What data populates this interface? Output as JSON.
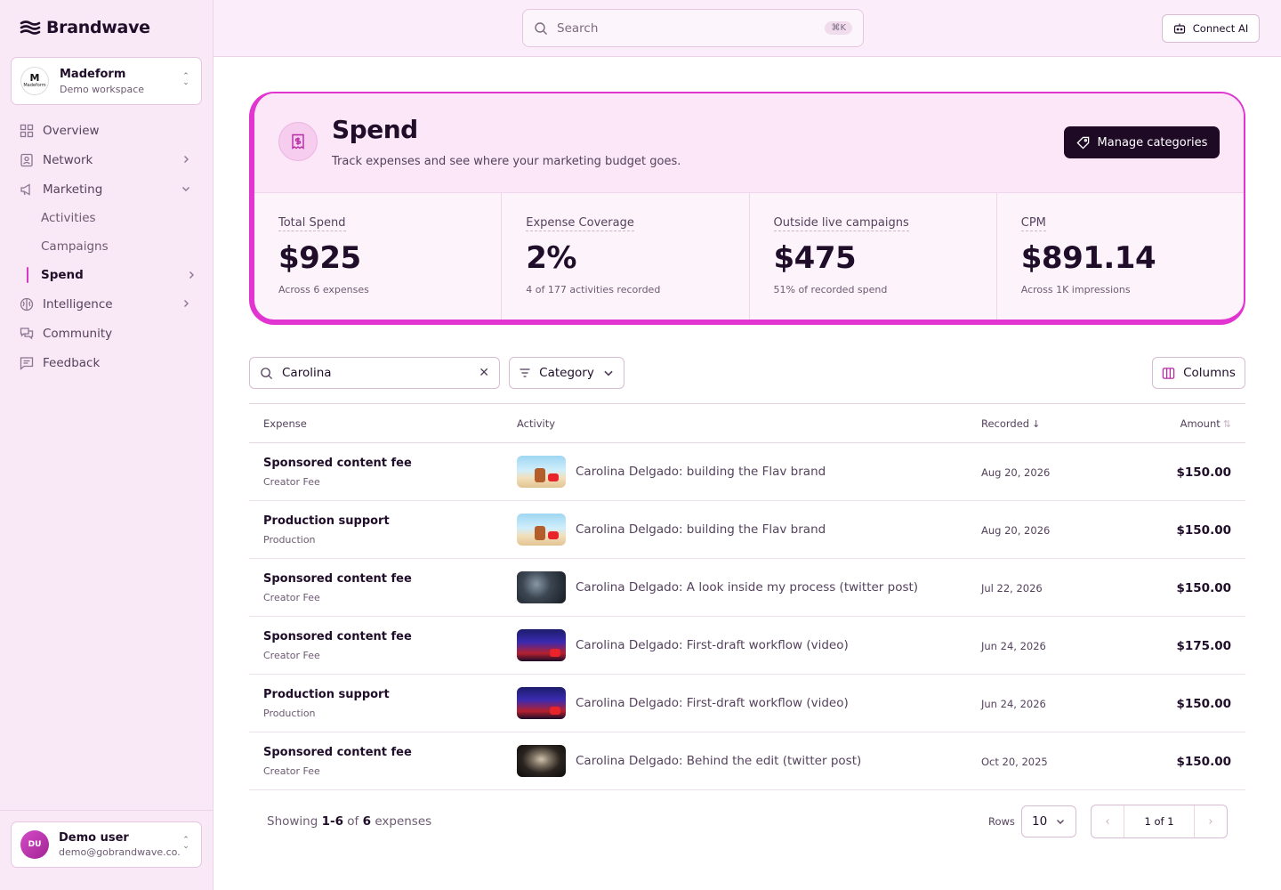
{
  "brand": {
    "name": "Brandwave"
  },
  "workspace": {
    "logo_text": "M",
    "logo_sub": "Madeform",
    "name": "Madeform",
    "subtitle": "Demo workspace"
  },
  "nav": {
    "overview": "Overview",
    "network": "Network",
    "marketing": "Marketing",
    "marketing_sub": [
      "Activities",
      "Campaigns",
      "Spend"
    ],
    "intelligence": "Intelligence",
    "community": "Community",
    "feedback": "Feedback"
  },
  "user": {
    "initials": "DU",
    "name": "Demo user",
    "email": "demo@gobrandwave.co..."
  },
  "topbar": {
    "search_placeholder": "Search",
    "shortcut": "⌘K",
    "connect_label": "Connect AI"
  },
  "page": {
    "title": "Spend",
    "subtitle": "Track expenses and see where your marketing budget goes.",
    "manage_label": "Manage categories"
  },
  "stats": [
    {
      "label": "Total Spend",
      "value": "$925",
      "sub": "Across 6 expenses"
    },
    {
      "label": "Expense Coverage",
      "value": "2%",
      "sub": "4 of 177 activities recorded"
    },
    {
      "label": "Outside live campaigns",
      "value": "$475",
      "sub": "51% of recorded spend"
    },
    {
      "label": "CPM",
      "value": "$891.14",
      "sub": "Across 1K impressions"
    }
  ],
  "filters": {
    "search_value": "Carolina",
    "category_label": "Category",
    "columns_label": "Columns"
  },
  "table": {
    "headers": {
      "expense": "Expense",
      "activity": "Activity",
      "recorded": "Recorded",
      "amount": "Amount"
    },
    "rows": [
      {
        "expense": "Sponsored content fee",
        "category": "Creator Fee",
        "thumb": "beach",
        "activity": "Carolina Delgado: building the Flav brand",
        "recorded": "Aug 20, 2026",
        "amount": "$150.00"
      },
      {
        "expense": "Production support",
        "category": "Production",
        "thumb": "beach",
        "activity": "Carolina Delgado: building the Flav brand",
        "recorded": "Aug 20, 2026",
        "amount": "$150.00"
      },
      {
        "expense": "Sponsored content fee",
        "category": "Creator Fee",
        "thumb": "dark",
        "activity": "Carolina Delgado: A look inside my process (twitter post)",
        "recorded": "Jul 22, 2026",
        "amount": "$150.00"
      },
      {
        "expense": "Sponsored content fee",
        "category": "Creator Fee",
        "thumb": "stage",
        "activity": "Carolina Delgado: First-draft workflow (video)",
        "recorded": "Jun 24, 2026",
        "amount": "$175.00"
      },
      {
        "expense": "Production support",
        "category": "Production",
        "thumb": "stage",
        "activity": "Carolina Delgado: First-draft workflow (video)",
        "recorded": "Jun 24, 2026",
        "amount": "$150.00"
      },
      {
        "expense": "Sponsored content fee",
        "category": "Creator Fee",
        "thumb": "portrait",
        "activity": "Carolina Delgado: Behind the edit (twitter post)",
        "recorded": "Oct 20, 2025",
        "amount": "$150.00"
      }
    ]
  },
  "pagination": {
    "showing_prefix": "Showing",
    "showing_range": "1-6",
    "showing_of": "of",
    "showing_total": "6",
    "showing_suffix": "expenses",
    "rows_label": "Rows",
    "rows_value": "10",
    "page_info": "1 of 1"
  },
  "colors": {
    "accent": "#e234d1",
    "primary_dark": "#1f0a26",
    "sidebar_bg": "#f9e8f6"
  }
}
